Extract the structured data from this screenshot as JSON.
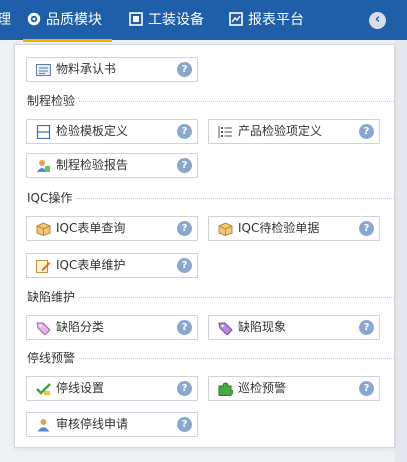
{
  "nav": {
    "items": [
      {
        "label": "理",
        "icon": "none"
      },
      {
        "label": "品质模块",
        "icon": "gear-icon"
      },
      {
        "label": "工装设备",
        "icon": "frame-icon"
      },
      {
        "label": "报表平台",
        "icon": "chart-icon"
      }
    ],
    "active": "品质模块",
    "collapse_icon": "chevron-left-icon"
  },
  "menu": {
    "top_item": {
      "label": "物料承认书",
      "icon": "document-icon"
    },
    "sections": [
      {
        "title": "制程检验",
        "items": [
          {
            "label": "检验模板定义",
            "icon": "template-icon"
          },
          {
            "label": "产品检验项定义",
            "icon": "list-icon"
          },
          {
            "label": "制程检验报告",
            "icon": "user-report-icon"
          }
        ]
      },
      {
        "title": "IQC操作",
        "items": [
          {
            "label": "IQC表单查询",
            "icon": "box-icon"
          },
          {
            "label": "IQC待检验单据",
            "icon": "box-icon"
          },
          {
            "label": "IQC表单维护",
            "icon": "edit-icon"
          }
        ]
      },
      {
        "title": "缺陷维护",
        "items": [
          {
            "label": "缺陷分类",
            "icon": "tag-icon"
          },
          {
            "label": "缺陷现象",
            "icon": "tag-icon"
          }
        ]
      },
      {
        "title": "停线预警",
        "items": [
          {
            "label": "停线设置",
            "icon": "checkmark-icon"
          },
          {
            "label": "巡检预警",
            "icon": "puzzle-icon"
          },
          {
            "label": "审核停线申请",
            "icon": "user-icon"
          }
        ]
      }
    ],
    "help_glyph": "?"
  },
  "colors": {
    "nav_bg": "#1f5ea8",
    "active_underline": "#f0b400",
    "help_bg": "#8aa8cf"
  }
}
